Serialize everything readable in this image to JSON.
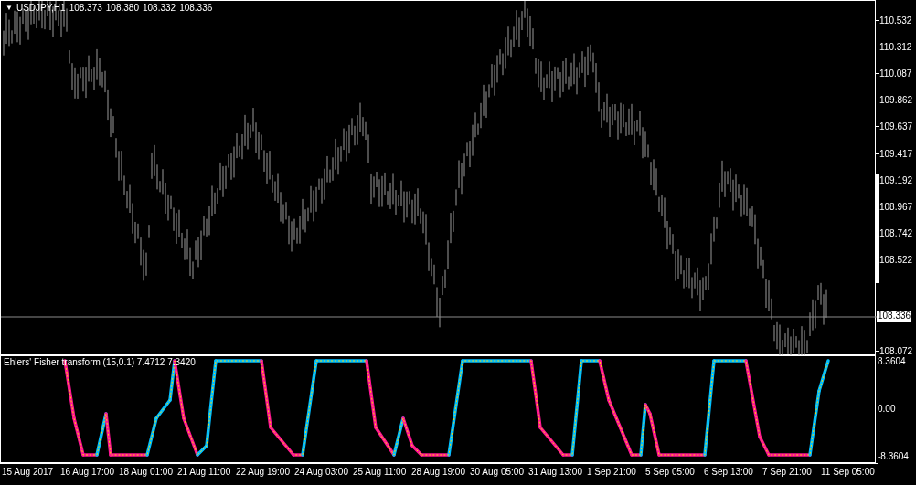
{
  "chart_header": {
    "menu_marker": "▼",
    "symbol": "USDJPY,H1",
    "ohlc": [
      "108.373",
      "108.380",
      "108.332",
      "108.336"
    ]
  },
  "price_axis": {
    "ticks": [
      "110.532",
      "110.312",
      "110.087",
      "109.862",
      "109.637",
      "109.417",
      "109.192",
      "108.967",
      "108.742",
      "108.522"
    ],
    "bottom_tick": "108.072",
    "current_price": "108.336"
  },
  "indicator": {
    "title": "Ehlers' Fisher transform (15,0.1) 7.4712 7.3420",
    "axis_ticks": [
      "8.3604",
      "0.00",
      "-8.3604"
    ]
  },
  "time_axis": {
    "labels": [
      "15 Aug 2017",
      "16 Aug 17:00",
      "18 Aug 01:00",
      "21 Aug 11:00",
      "22 Aug 19:00",
      "24 Aug 03:00",
      "25 Aug 11:00",
      "28 Aug 19:00",
      "30 Aug 05:00",
      "31 Aug 13:00",
      "1 Sep 21:00",
      "5 Sep 05:00",
      "6 Sep 13:00",
      "7 Sep 21:00",
      "11 Sep 05:00"
    ]
  }
}
